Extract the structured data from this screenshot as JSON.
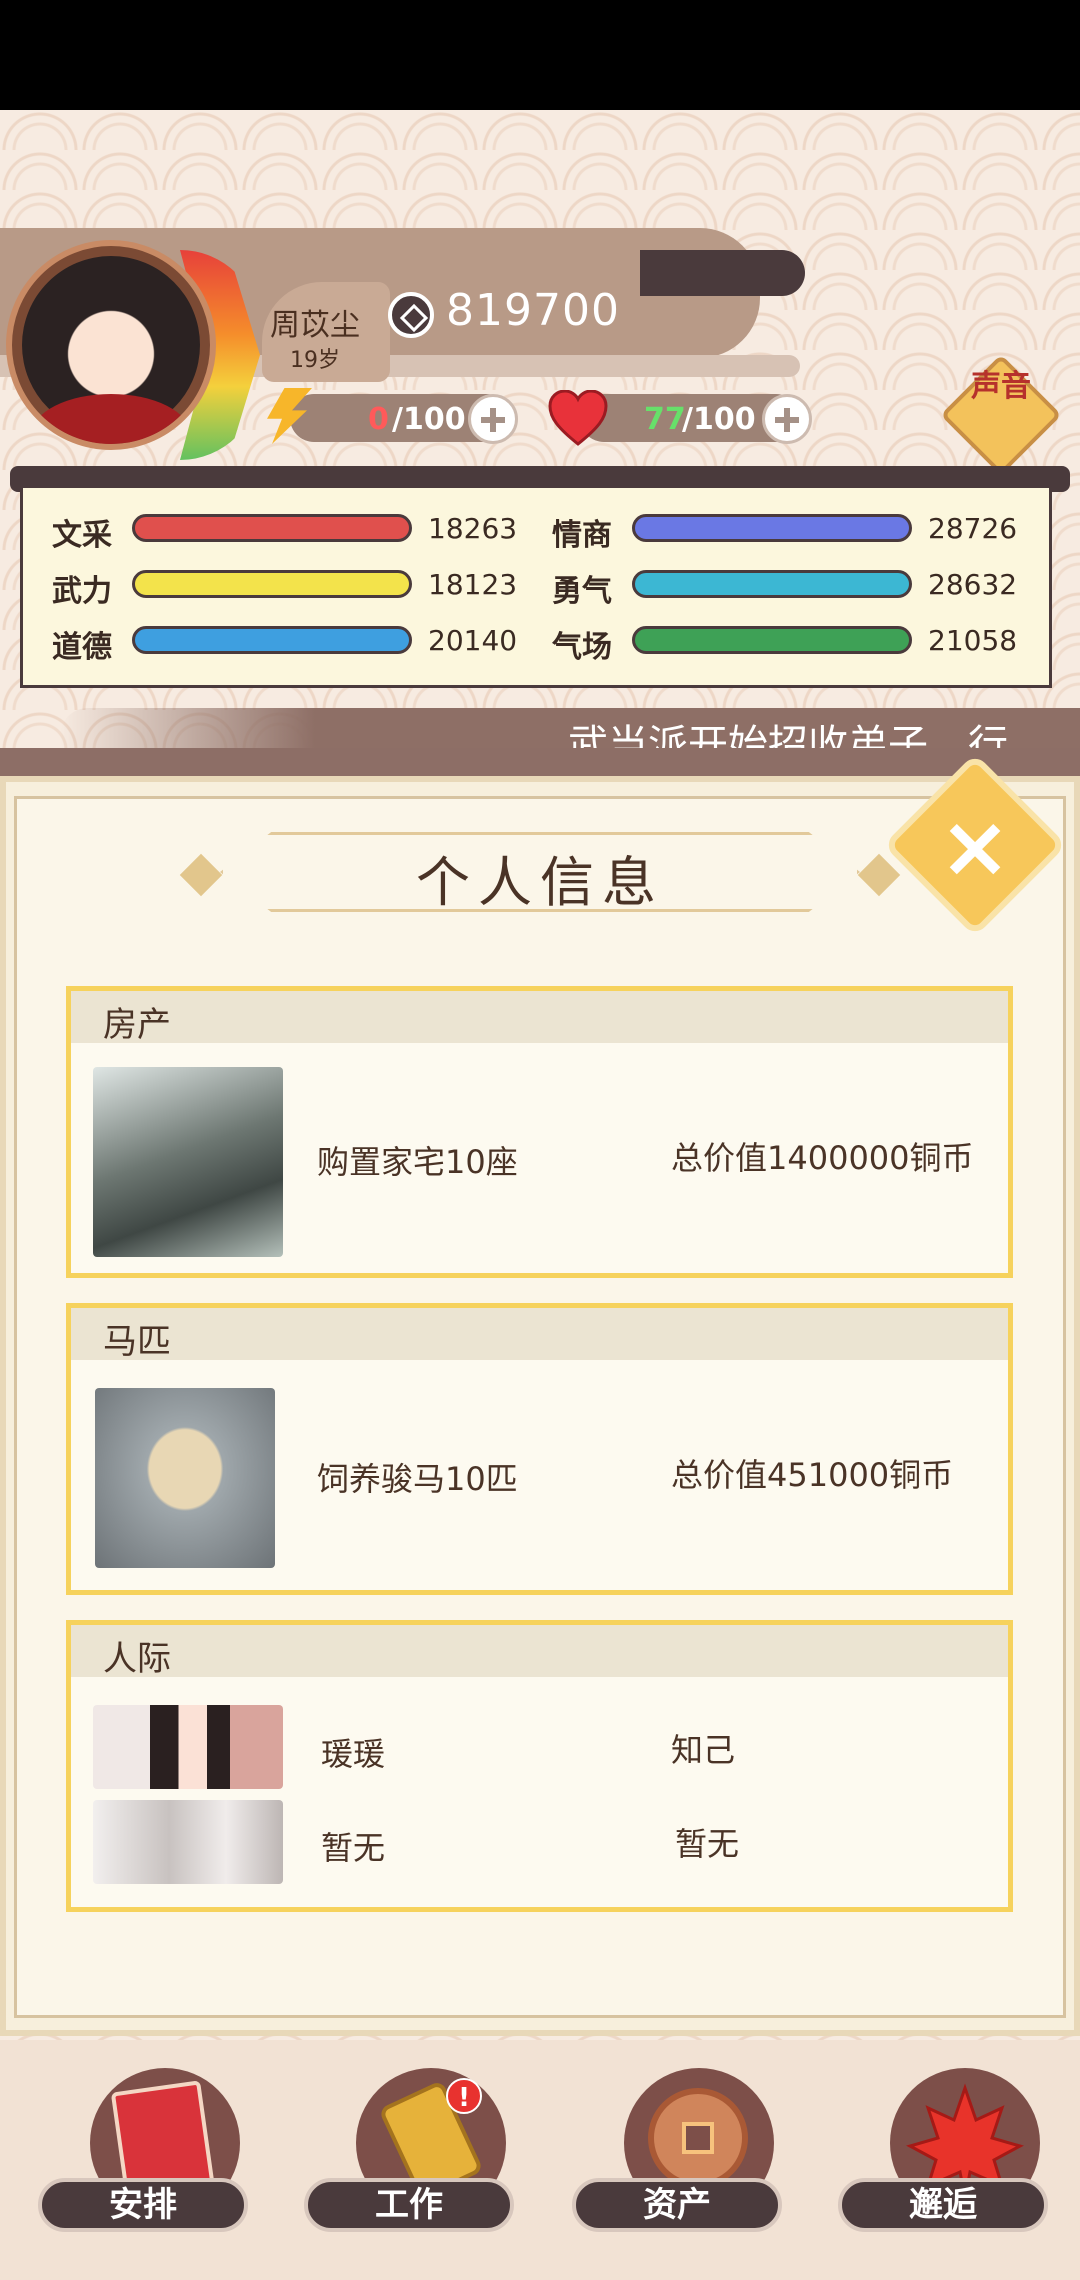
{
  "player": {
    "name": "周苡尘",
    "age": "19岁",
    "coins": "819700",
    "energy_value": "0",
    "energy_max": "/100",
    "health_value": "77",
    "health_max": "/100"
  },
  "sound_button": {
    "label": "声音"
  },
  "stats": [
    {
      "label": "文采",
      "value": "18263",
      "color": "#e0504d"
    },
    {
      "label": "情商",
      "value": "28726",
      "color": "#6a78e4"
    },
    {
      "label": "武力",
      "value": "18123",
      "color": "#f3e34b"
    },
    {
      "label": "勇气",
      "value": "28632",
      "color": "#3cb7d3"
    },
    {
      "label": "道德",
      "value": "20140",
      "color": "#3e9fe0"
    },
    {
      "label": "气场",
      "value": "21058",
      "color": "#3ea156"
    }
  ],
  "ticker": {
    "text": "武当派开始招收弟子，行"
  },
  "panel": {
    "title": "个人信息"
  },
  "cards": {
    "property": {
      "header": "房产",
      "desc": "购置家宅10座",
      "value": "总价值1400000铜币"
    },
    "horse": {
      "header": "马匹",
      "desc": "饲养骏马10匹",
      "value": "总价值451000铜币"
    },
    "relations": {
      "header": "人际",
      "rows": [
        {
          "name": "瑗瑗",
          "relation": "知己"
        },
        {
          "name": "暂无",
          "relation": "暂无"
        }
      ]
    }
  },
  "nav": [
    {
      "label": "安排",
      "icon": "book-icon"
    },
    {
      "label": "工作",
      "icon": "work-seal-icon",
      "badge": "!"
    },
    {
      "label": "资产",
      "icon": "coin-icon"
    },
    {
      "label": "邂逅",
      "icon": "maple-leaf-icon"
    }
  ]
}
